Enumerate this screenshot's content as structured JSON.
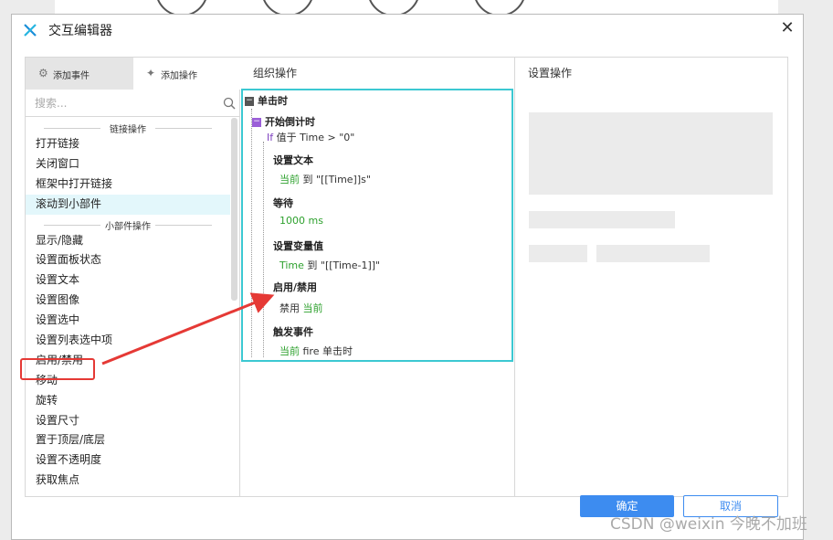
{
  "dialog": {
    "title": "交互编辑器",
    "close_icon": "close-icon"
  },
  "left": {
    "tab_add_event": "添加事件",
    "tab_add_action": "添加操作",
    "search_placeholder": "搜索...",
    "sections": [
      {
        "title": "链接操作",
        "items": [
          "打开链接",
          "关闭窗口",
          "框架中打开链接",
          "滚动到小部件"
        ]
      },
      {
        "title": "小部件操作",
        "items": [
          "显示/隐藏",
          "设置面板状态",
          "设置文本",
          "设置图像",
          "设置选中",
          "设置列表选中项",
          "启用/禁用",
          "移动",
          "旋转",
          "设置尺寸",
          "置于顶层/底层",
          "设置不透明度",
          "获取焦点"
        ]
      }
    ]
  },
  "middle": {
    "header": "组织操作",
    "event": "单击时",
    "case": "开始倒计时",
    "condition_if": "If",
    "condition_text": "值于 Time > \"0\"",
    "actions": [
      {
        "title": "设置文本",
        "detail_target": "当前",
        "detail_text": "到 \"[[Time]]s\""
      },
      {
        "title": "等待",
        "detail_target": "1000 ms",
        "detail_text": ""
      },
      {
        "title": "设置变量值",
        "detail_target": "Time",
        "detail_text": "到 \"[[Time-1]]\""
      },
      {
        "title": "启用/禁用",
        "detail_prefix": "禁用",
        "detail_target": "当前",
        "detail_text": ""
      },
      {
        "title": "触发事件",
        "detail_target": "当前",
        "detail_text": "fire 单击时"
      }
    ]
  },
  "right": {
    "header": "设置操作"
  },
  "buttons": {
    "ok": "确定",
    "cancel": "取消"
  },
  "watermark": "CSDN @weixin 今晚不加班",
  "colors": {
    "accent": "#3d8cf0",
    "tree_border": "#3cc8d2",
    "target_green": "#2ea12e",
    "annotation_red": "#e53935",
    "highlight_row": "#e3f7fb"
  }
}
